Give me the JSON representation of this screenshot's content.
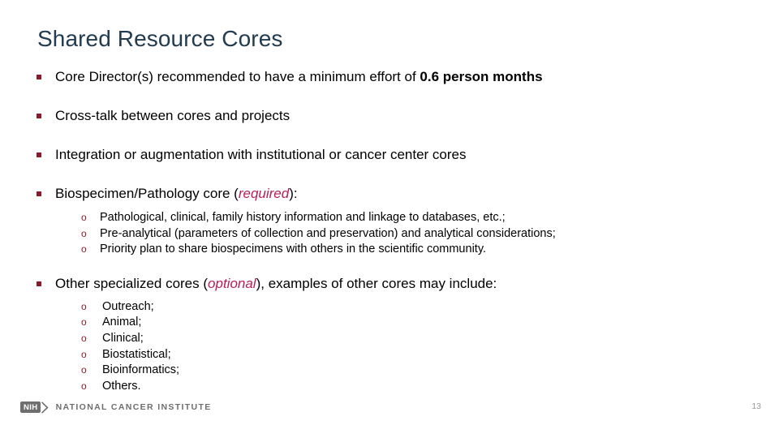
{
  "slide": {
    "title": "Shared Resource Cores",
    "page_number": "13",
    "accent_bullet_color": "#8C1A2B",
    "title_color": "#223B4F",
    "emphasis_color": "#B4205A",
    "footer_color": "#6E6E6E"
  },
  "bullets": [
    {
      "pre": "Core Director(s) recommended to have a minimum effort of ",
      "bold": "0.6 person months",
      "post": ""
    },
    {
      "pre": "Cross-talk between cores and projects",
      "bold": "",
      "post": ""
    },
    {
      "pre": "Integration or augmentation with institutional or cancer center cores",
      "bold": "",
      "post": ""
    },
    {
      "pre": "Biospecimen/Pathology core (",
      "emphasis": "required",
      "post": "):"
    },
    {
      "pre": "Other specialized cores (",
      "emphasis": "optional",
      "post": "), examples of other cores may include:"
    }
  ],
  "biospecimen_subitems": [
    "Pathological, clinical, family history information and linkage to databases, etc.;",
    "Pre-analytical (parameters of collection and preservation) and analytical considerations;",
    "Priority plan to share biospecimens with others in the scientific community."
  ],
  "specialized_subitems": [
    "Outreach;",
    "Animal;",
    "Clinical;",
    "Biostatistical;",
    "Bioinformatics;",
    "Others."
  ],
  "sub_marker": "o",
  "footer": {
    "nih_mark": "NIH",
    "organization": "NATIONAL CANCER INSTITUTE"
  }
}
